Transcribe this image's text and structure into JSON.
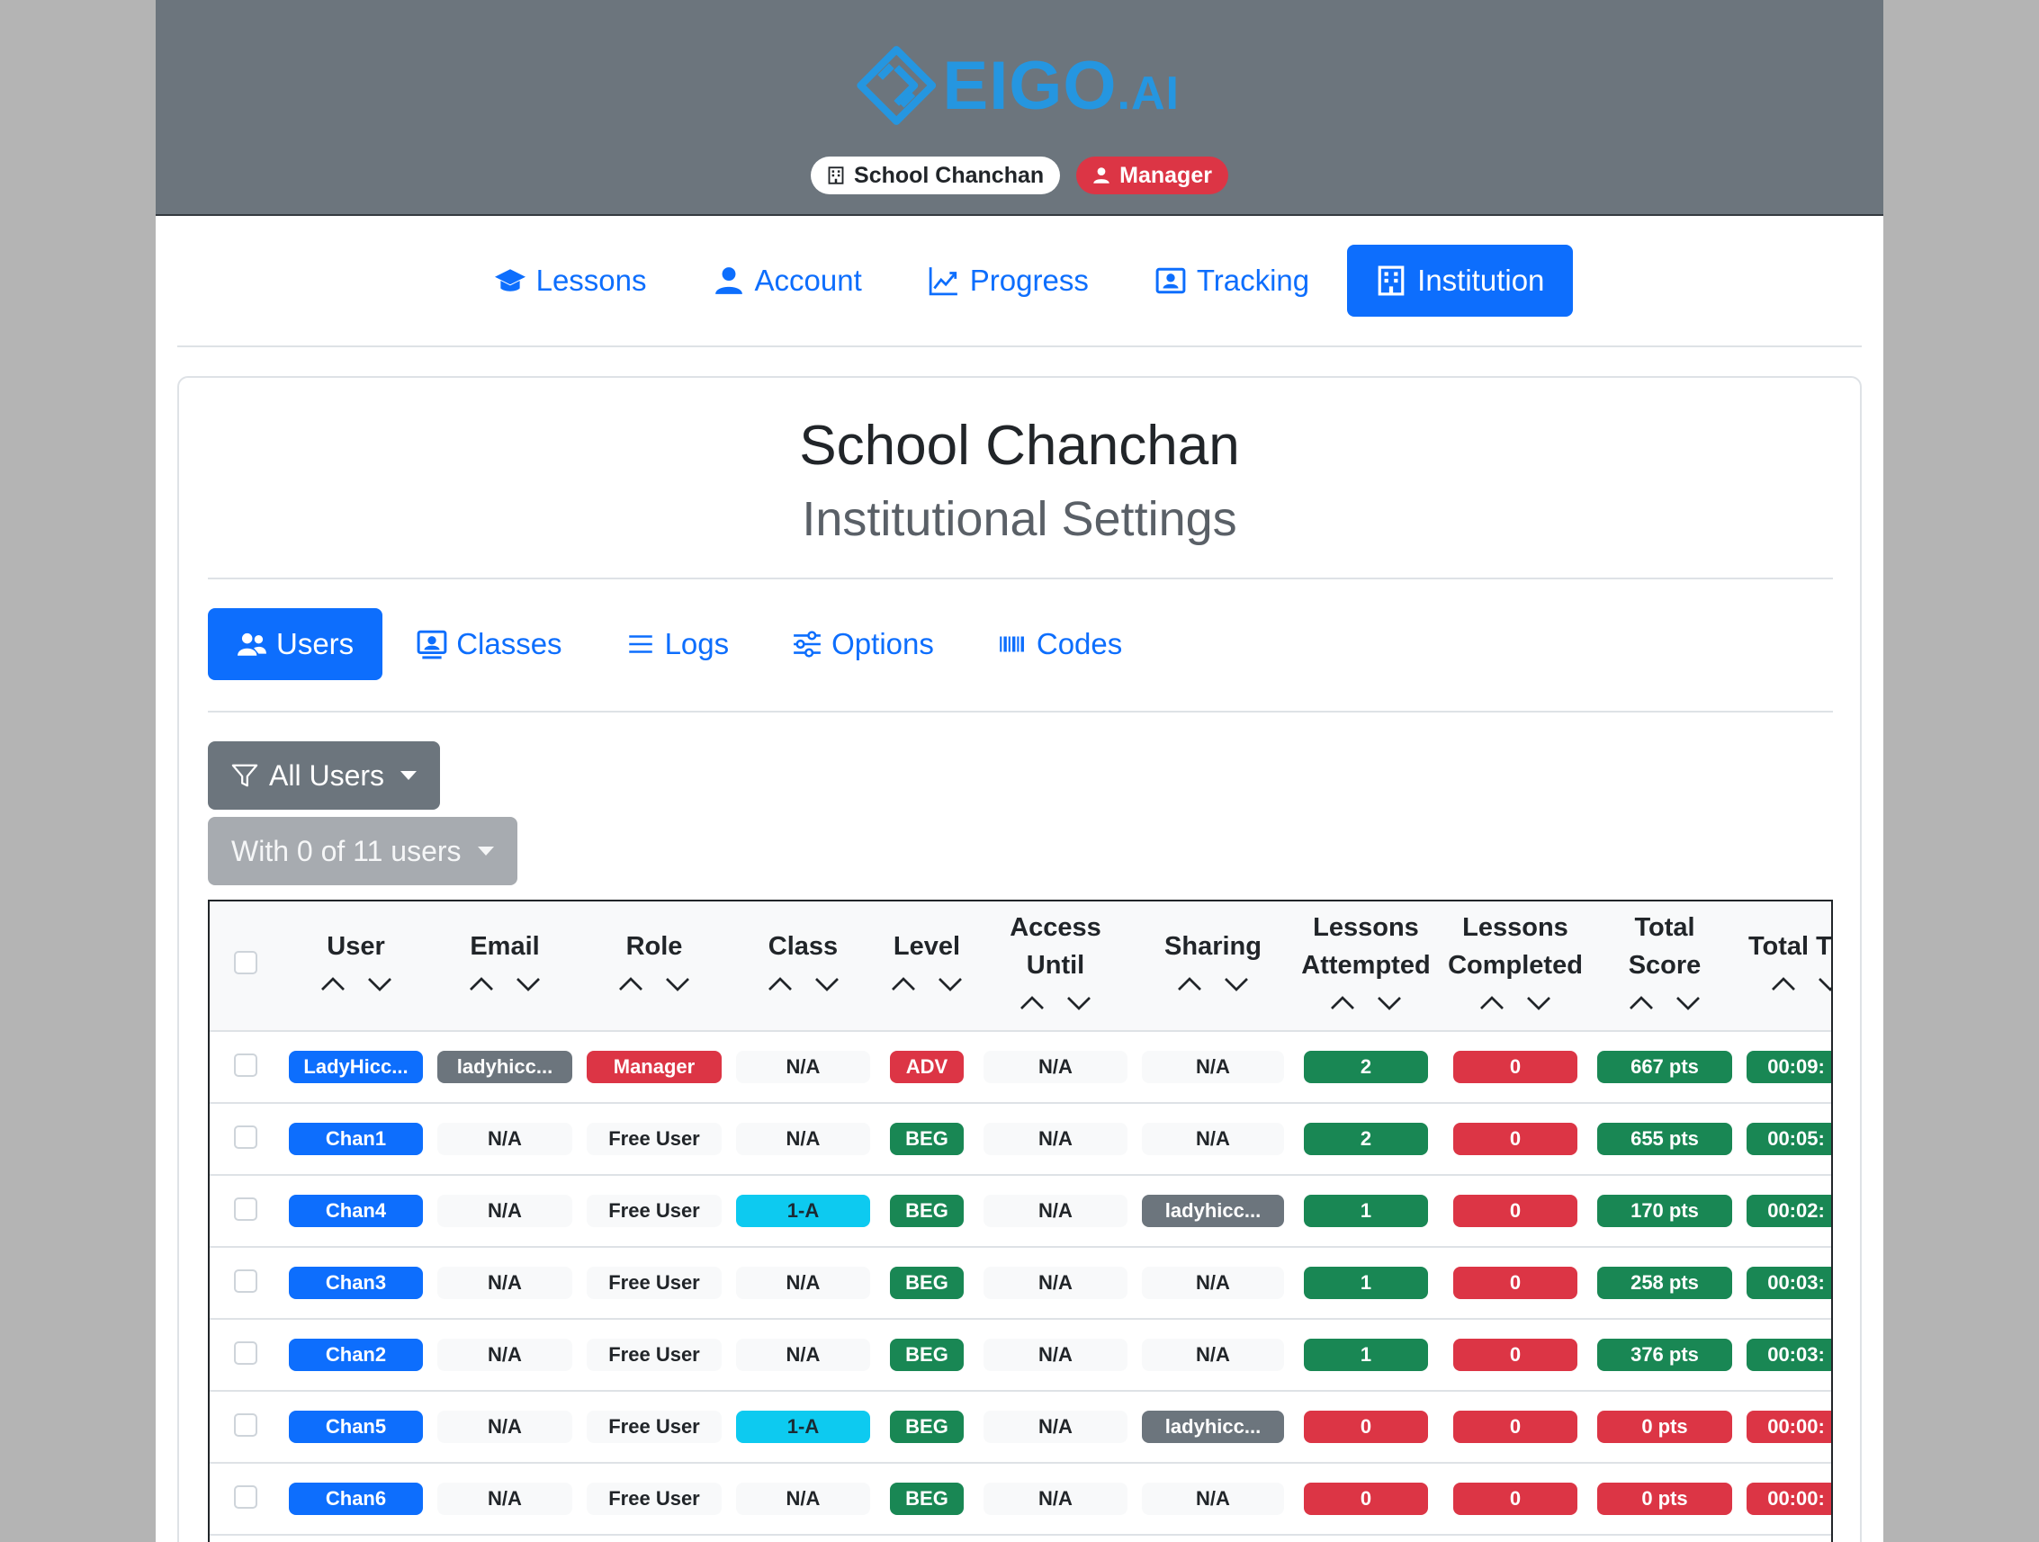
{
  "header": {
    "logo_text": "EIGO",
    "logo_suffix": ".AI",
    "institution_badge": "School Chanchan",
    "role_badge": "Manager"
  },
  "nav": [
    {
      "label": "Lessons",
      "icon": "graduation-cap-icon",
      "active": false
    },
    {
      "label": "Account",
      "icon": "person-icon",
      "active": false
    },
    {
      "label": "Progress",
      "icon": "graph-up-icon",
      "active": false
    },
    {
      "label": "Tracking",
      "icon": "person-badge-icon",
      "active": false
    },
    {
      "label": "Institution",
      "icon": "building-icon",
      "active": true
    }
  ],
  "page": {
    "title": "School Chanchan",
    "subtitle": "Institutional Settings"
  },
  "subnav": [
    {
      "label": "Users",
      "icon": "people-icon",
      "active": true
    },
    {
      "label": "Classes",
      "icon": "person-video-icon",
      "active": false
    },
    {
      "label": "Logs",
      "icon": "list-icon",
      "active": false
    },
    {
      "label": "Options",
      "icon": "sliders-icon",
      "active": false
    },
    {
      "label": "Codes",
      "icon": "barcode-icon",
      "active": false
    }
  ],
  "filters": {
    "user_filter_label": "All Users",
    "selection_label": "With 0 of 11 users"
  },
  "colors": {
    "primary": "#0d6efd",
    "secondary": "#6c757d",
    "danger": "#dc3545",
    "success": "#198754",
    "info": "#0dcaf0",
    "logo": "#2596e0"
  },
  "table": {
    "columns": [
      {
        "line1": "User",
        "line2": ""
      },
      {
        "line1": "Email",
        "line2": ""
      },
      {
        "line1": "Role",
        "line2": ""
      },
      {
        "line1": "Class",
        "line2": ""
      },
      {
        "line1": "Level",
        "line2": ""
      },
      {
        "line1": "Access",
        "line2": "Until"
      },
      {
        "line1": "Sharing",
        "line2": ""
      },
      {
        "line1": "Lessons",
        "line2": "Attempted"
      },
      {
        "line1": "Lessons",
        "line2": "Completed"
      },
      {
        "line1": "Total",
        "line2": "Score"
      },
      {
        "line1": "Total Ti",
        "line2": ""
      }
    ],
    "rows": [
      {
        "user": "LadyHicc...",
        "email": "ladyhicc...",
        "role": "Manager",
        "class": "N/A",
        "level": "ADV",
        "access": "N/A",
        "sharing": "N/A",
        "attempted": "2",
        "completed": "0",
        "score": "667 pts",
        "time": "00:09:"
      },
      {
        "user": "Chan1",
        "email": "N/A",
        "role": "Free User",
        "class": "N/A",
        "level": "BEG",
        "access": "N/A",
        "sharing": "N/A",
        "attempted": "2",
        "completed": "0",
        "score": "655 pts",
        "time": "00:05:"
      },
      {
        "user": "Chan4",
        "email": "N/A",
        "role": "Free User",
        "class": "1-A",
        "level": "BEG",
        "access": "N/A",
        "sharing": "ladyhicc...",
        "attempted": "1",
        "completed": "0",
        "score": "170 pts",
        "time": "00:02:"
      },
      {
        "user": "Chan3",
        "email": "N/A",
        "role": "Free User",
        "class": "N/A",
        "level": "BEG",
        "access": "N/A",
        "sharing": "N/A",
        "attempted": "1",
        "completed": "0",
        "score": "258 pts",
        "time": "00:03:"
      },
      {
        "user": "Chan2",
        "email": "N/A",
        "role": "Free User",
        "class": "N/A",
        "level": "BEG",
        "access": "N/A",
        "sharing": "N/A",
        "attempted": "1",
        "completed": "0",
        "score": "376 pts",
        "time": "00:03:"
      },
      {
        "user": "Chan5",
        "email": "N/A",
        "role": "Free User",
        "class": "1-A",
        "level": "BEG",
        "access": "N/A",
        "sharing": "ladyhicc...",
        "attempted": "0",
        "completed": "0",
        "score": "0 pts",
        "time": "00:00:"
      },
      {
        "user": "Chan6",
        "email": "N/A",
        "role": "Free User",
        "class": "N/A",
        "level": "BEG",
        "access": "N/A",
        "sharing": "N/A",
        "attempted": "0",
        "completed": "0",
        "score": "0 pts",
        "time": "00:00:"
      }
    ]
  }
}
